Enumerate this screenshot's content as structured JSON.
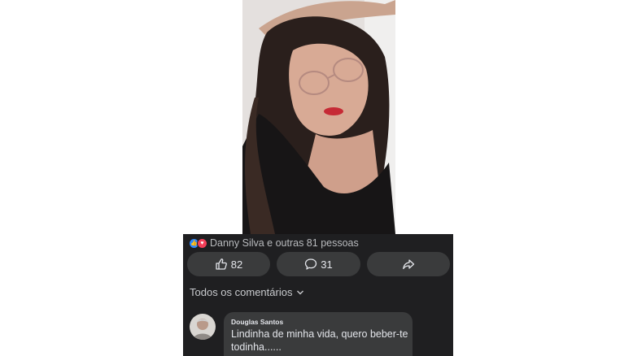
{
  "post": {
    "photo_icon": "profile-photo",
    "reactions": {
      "icons": [
        "like-icon",
        "love-icon"
      ],
      "summary": "Danny Silva e outras 81 pessoas"
    },
    "actions": {
      "like_count": "82",
      "comment_count": "31",
      "share_icon": "share-icon"
    },
    "comments_filter": "Todos os comentários",
    "comments": [
      {
        "author": "Douglas Santos",
        "text": "Lindinha de minha vida, quero beber-te todinha......"
      }
    ]
  },
  "colors": {
    "panel_bg": "#1f1f21",
    "button_bg": "#3a3b3c",
    "like_blue": "#2d88ff",
    "love_red": "#f33e58"
  }
}
